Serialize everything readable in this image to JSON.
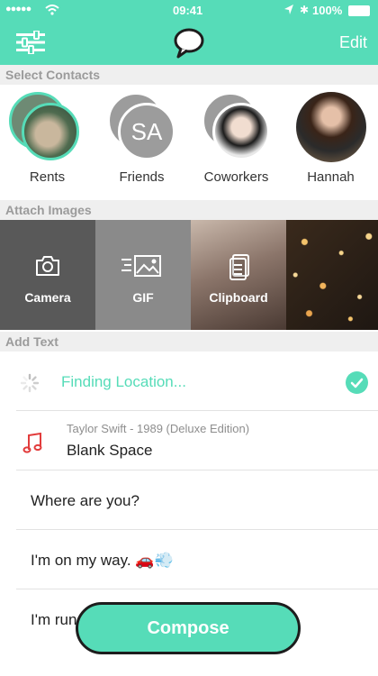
{
  "status": {
    "signal": "●●●●●",
    "time": "09:41",
    "battery": "100%"
  },
  "header": {
    "menu_icon": "sliders-icon",
    "logo_icon": "chat-bubble-icon",
    "edit_label": "Edit"
  },
  "sections": {
    "contacts": "Select Contacts",
    "images": "Attach Images",
    "text": "Add Text"
  },
  "contacts": [
    {
      "label": "Rents"
    },
    {
      "label": "Friends",
      "initials": "SA"
    },
    {
      "label": "Coworkers"
    },
    {
      "label": "Hannah"
    }
  ],
  "tiles": [
    {
      "label": "Camera",
      "icon": "camera-icon"
    },
    {
      "label": "GIF",
      "icon": "gif-image-icon"
    },
    {
      "label": "Clipboard",
      "icon": "clipboard-icon"
    },
    {
      "label": ""
    }
  ],
  "location": {
    "text": "Finding Location...",
    "icon": "spinner-icon"
  },
  "music": {
    "subtitle": "Taylor Swift - 1989 (Deluxe Edition)",
    "title": "Blank Space",
    "icon": "music-note-icon"
  },
  "messages": [
    {
      "text": "Where are you?"
    },
    {
      "text": "I'm on my way. 🚗💨"
    },
    {
      "text": "I'm run"
    }
  ],
  "compose_label": "Compose",
  "colors": {
    "accent": "#56dcb8",
    "music_note": "#e23c3c"
  }
}
